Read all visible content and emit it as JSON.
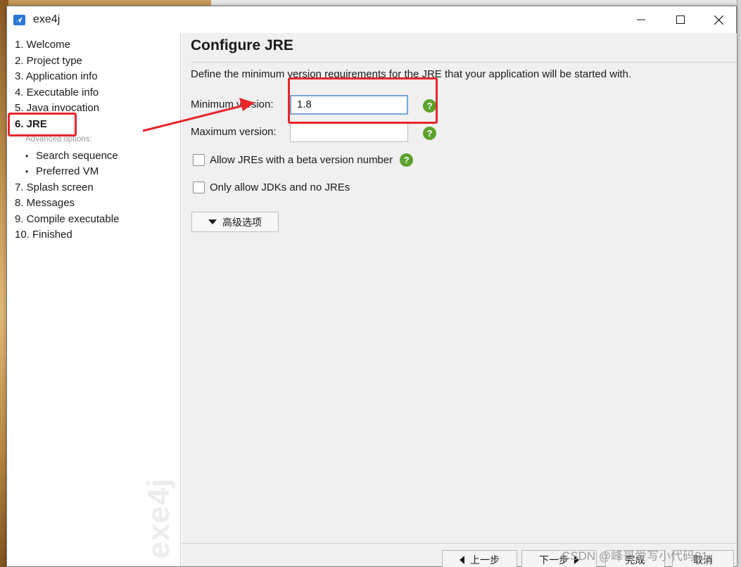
{
  "window": {
    "title": "exe4j"
  },
  "sidebar": {
    "items": [
      {
        "label": "1. Welcome"
      },
      {
        "label": "2. Project type"
      },
      {
        "label": "3. Application info"
      },
      {
        "label": "4. Executable info"
      },
      {
        "label": "5. Java invocation"
      },
      {
        "label": "6. JRE"
      },
      {
        "label": "7. Splash screen"
      },
      {
        "label": "8. Messages"
      },
      {
        "label": "9. Compile executable"
      },
      {
        "label": "10. Finished"
      }
    ],
    "advanced_label": "Advanced options:",
    "sub_items": [
      {
        "label": "Search sequence"
      },
      {
        "label": "Preferred VM"
      }
    ],
    "watermark": "exe4j"
  },
  "main": {
    "title": "Configure JRE",
    "description": "Define the minimum version requirements for the JRE that your application will be started with.",
    "min_version_label": "Minimum version:",
    "min_version_value": "1.8",
    "max_version_label": "Maximum version:",
    "max_version_value": "",
    "help_glyph": "?",
    "beta_checkbox_label": "Allow JREs with a beta version number",
    "jdk_checkbox_label": "Only allow JDKs and no JREs",
    "advanced_button": "高级选项"
  },
  "footer": {
    "back": "上一步",
    "next": "下一步",
    "finish": "完成",
    "cancel": "取消"
  },
  "overlay": {
    "watermark_text": "CSDN @峰哥爱写小代码01",
    "annotation_color": "#e8262a"
  }
}
